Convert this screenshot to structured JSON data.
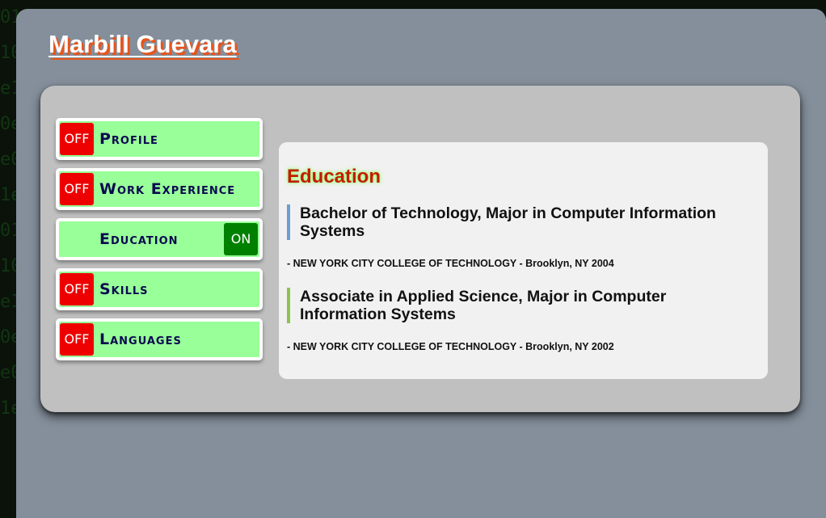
{
  "header": {
    "name": "Marbill Guevara"
  },
  "nav": {
    "items": [
      {
        "label": "Profile",
        "toggle": "OFF",
        "active": false
      },
      {
        "label": "Work Experience",
        "toggle": "OFF",
        "active": false
      },
      {
        "label": "Education",
        "toggle": "ON",
        "active": true
      },
      {
        "label": "Skills",
        "toggle": "OFF",
        "active": false
      },
      {
        "label": "Languages",
        "toggle": "OFF",
        "active": false
      }
    ]
  },
  "content": {
    "heading": "Education",
    "entries": [
      {
        "degree": "Bachelor of Technology, Major in Computer Information Systems",
        "school": "- NEW YORK CITY COLLEGE OF TECHNOLOGY - Brooklyn, NY 2004"
      },
      {
        "degree": "Associate in Applied Science, Major in Computer Information Systems",
        "school": "- NEW YORK CITY COLLEGE OF TECHNOLOGY - Brooklyn, NY 2002"
      }
    ]
  },
  "colors": {
    "off": "#ee0000",
    "on": "#008000",
    "nav_bg": "#99ff99",
    "heading": "#c41c00",
    "title_shadow": "#e8541c"
  }
}
